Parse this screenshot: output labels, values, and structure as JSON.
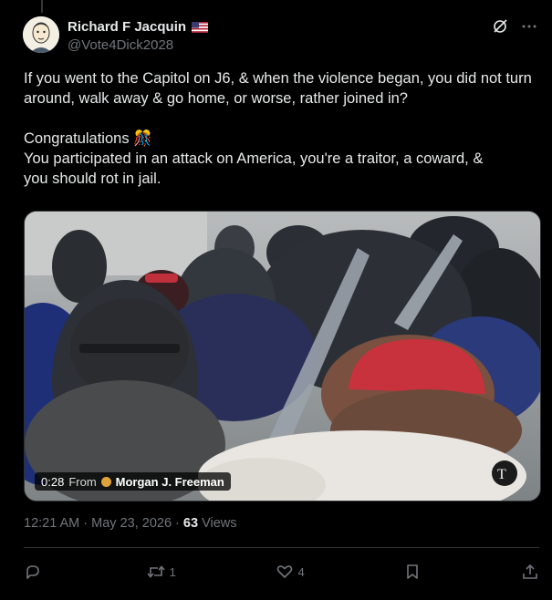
{
  "author": {
    "display_name": "Richard F Jacquin",
    "handle": "@Vote4Dick2028",
    "flag_icon": "us-flag-icon"
  },
  "tweet": {
    "text": "If you went to the Capitol on J6, & when the violence began, you did not turn around, walk away & go home, or worse, rather joined in?\n\nCongratulations 🎊\nYou participated in an attack on America, you're a traitor, a coward, &\nyou should rot in jail."
  },
  "video": {
    "duration": "0:28",
    "from_label": "From",
    "source": "Morgan J. Freeman"
  },
  "meta": {
    "timestamp": "12:21 AM · May 23, 2026 · ",
    "views_count": "63",
    "views_label": " Views"
  },
  "actions": {
    "reply_count": "",
    "retweet_count": "1",
    "like_count": "4"
  },
  "colors": {
    "background": "#000000",
    "text": "#e7e9ea",
    "secondary": "#71767b",
    "border": "#2f3336"
  }
}
